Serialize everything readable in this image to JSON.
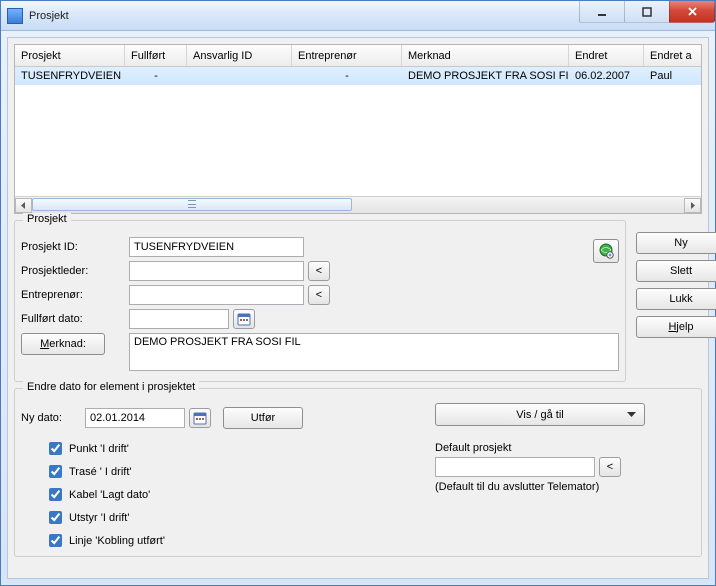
{
  "window": {
    "title": "Prosjekt"
  },
  "grid": {
    "headers": [
      "Prosjekt",
      "Fullført",
      "Ansvarlig ID",
      "Entreprenør",
      "Merknad",
      "Endret",
      "Endret a"
    ],
    "row": {
      "prosjekt": "TUSENFRYDVEIEN",
      "fullfort": "-",
      "ansvarlig": "",
      "entreprenor": "-",
      "merknad": "DEMO PROSJEKT FRA SOSI FIL",
      "endret": "06.02.2007",
      "endret_av": "Paul"
    }
  },
  "form_group_title": "Prosjekt",
  "form": {
    "labels": {
      "prosjekt_id": "Prosjekt ID:",
      "prosjektleder": "Prosjektleder:",
      "entreprenor": "Entreprenør:",
      "fullfort_dato": "Fullført dato:",
      "merknad_key": "M",
      "merknad_rest": "erknad:"
    },
    "values": {
      "prosjekt_id": "TUSENFRYDVEIEN",
      "prosjektleder": "",
      "entreprenor": "",
      "fullfort_dato": "",
      "merknad": "DEMO PROSJEKT FRA SOSI FIL"
    }
  },
  "side_buttons": {
    "ny": "Ny",
    "slett": "Slett",
    "lukk": "Lukk",
    "hjelp_key": "H",
    "hjelp_rest": "jelp"
  },
  "bottom": {
    "group_title": "Endre dato for element i prosjektet",
    "ny_dato_label": "Ny dato:",
    "ny_dato_value": "02.01.2014",
    "utfor": "Utfør",
    "dropdown": "Vis / gå til",
    "checks": [
      "Punkt 'I drift'",
      "Trasé ' I drift'",
      "Kabel 'Lagt dato'",
      "Utstyr 'I drift'",
      "Linje 'Kobling utført'"
    ],
    "default_label": "Default prosjekt",
    "default_value": "",
    "default_hint": "(Default til du avslutter Telemator)"
  }
}
